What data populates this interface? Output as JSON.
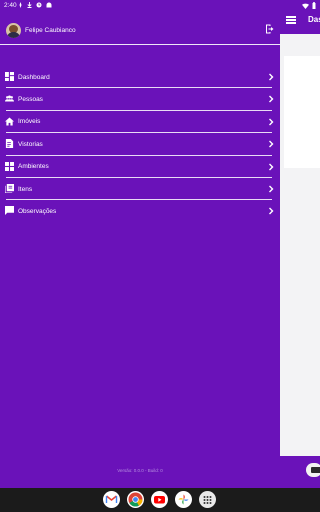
{
  "status_bar": {
    "time": "2:40"
  },
  "profile": {
    "name": "Felipe Caubianco"
  },
  "menu": [
    {
      "label": "Dashboard",
      "icon": "dashboard-icon"
    },
    {
      "label": "Pessoas",
      "icon": "people-icon"
    },
    {
      "label": "Imóveis",
      "icon": "home-icon"
    },
    {
      "label": "Vistorias",
      "icon": "inspection-icon"
    },
    {
      "label": "Ambientes",
      "icon": "grid-icon"
    },
    {
      "label": "Itens",
      "icon": "items-icon"
    },
    {
      "label": "Observações",
      "icon": "comment-icon"
    }
  ],
  "version_text": "Versão: 0.0.0 - Build: 0",
  "behind_app": {
    "title": "Das"
  },
  "colors": {
    "primary": "#6a12b9",
    "text": "#ffffff"
  }
}
